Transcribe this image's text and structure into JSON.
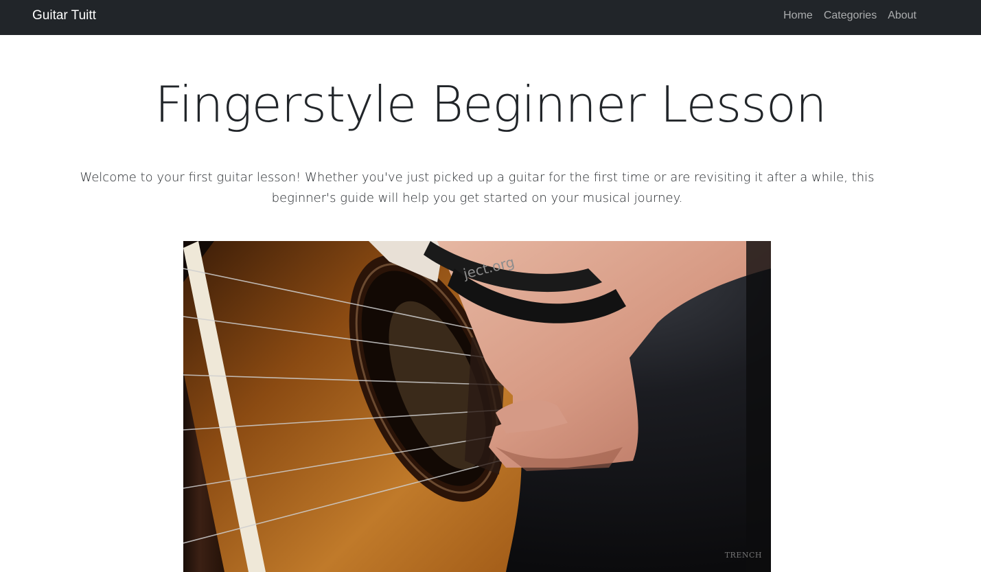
{
  "navbar": {
    "brand": "Guitar Tuitt",
    "links": [
      {
        "label": "Home"
      },
      {
        "label": "Categories"
      },
      {
        "label": "About"
      }
    ]
  },
  "main": {
    "title": "Fingerstyle Beginner Lesson",
    "intro": "Welcome to your first guitar lesson! Whether you've just picked up a guitar for the first time or are revisiting it after a while, this beginner's guide will help you get started on your musical journey."
  },
  "image": {
    "wristband_text": "ject.org",
    "watermark": "TRENCH"
  },
  "colors": {
    "navbar_bg": "#212529",
    "text": "#212529",
    "nav_link": "#9a9da0"
  }
}
